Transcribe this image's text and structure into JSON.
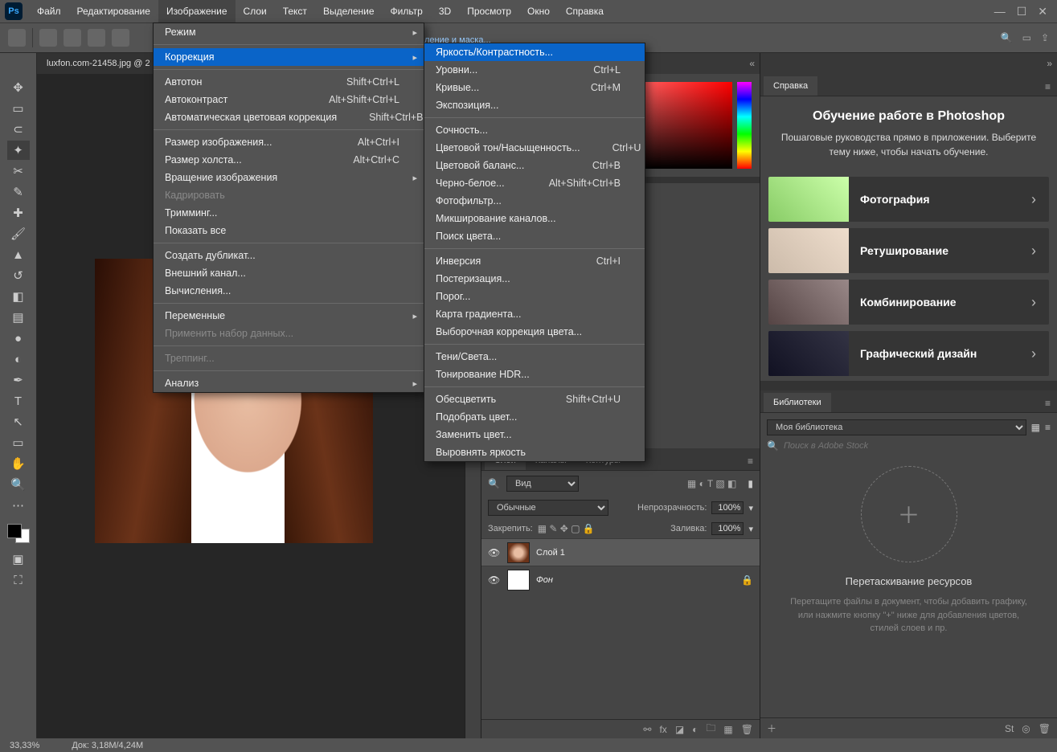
{
  "menubar": {
    "logo": "Ps",
    "items": [
      "Файл",
      "Редактирование",
      "Изображение",
      "Слои",
      "Текст",
      "Выделение",
      "Фильтр",
      "3D",
      "Просмотр",
      "Окно",
      "Справка"
    ],
    "active_index": 2
  },
  "doc_tab": "luxfon.com-21458.jpg @ 2",
  "partial_tab_text": "ление и маска...",
  "status": {
    "zoom": "33,33%",
    "doc": "Док: 3,18M/4,24M"
  },
  "menu_image": [
    {
      "t": "Режим",
      "sub": true
    },
    {
      "sep": true
    },
    {
      "t": "Коррекция",
      "sub": true,
      "hov": true
    },
    {
      "sep": true
    },
    {
      "t": "Автотон",
      "sc": "Shift+Ctrl+L"
    },
    {
      "t": "Автоконтраст",
      "sc": "Alt+Shift+Ctrl+L"
    },
    {
      "t": "Автоматическая цветовая коррекция",
      "sc": "Shift+Ctrl+B"
    },
    {
      "sep": true
    },
    {
      "t": "Размер изображения...",
      "sc": "Alt+Ctrl+I"
    },
    {
      "t": "Размер холста...",
      "sc": "Alt+Ctrl+C"
    },
    {
      "t": "Вращение изображения",
      "sub": true
    },
    {
      "t": "Кадрировать",
      "dis": true
    },
    {
      "t": "Тримминг..."
    },
    {
      "t": "Показать все"
    },
    {
      "sep": true
    },
    {
      "t": "Создать дубликат..."
    },
    {
      "t": "Внешний канал..."
    },
    {
      "t": "Вычисления..."
    },
    {
      "sep": true
    },
    {
      "t": "Переменные",
      "sub": true
    },
    {
      "t": "Применить набор данных...",
      "dis": true
    },
    {
      "sep": true
    },
    {
      "t": "Треппинг...",
      "dis": true
    },
    {
      "sep": true
    },
    {
      "t": "Анализ",
      "sub": true
    }
  ],
  "menu_correction": [
    {
      "t": "Яркость/Контрастность...",
      "hov": true
    },
    {
      "t": "Уровни...",
      "sc": "Ctrl+L"
    },
    {
      "t": "Кривые...",
      "sc": "Ctrl+M"
    },
    {
      "t": "Экспозиция..."
    },
    {
      "sep": true
    },
    {
      "t": "Сочность..."
    },
    {
      "t": "Цветовой тон/Насыщенность...",
      "sc": "Ctrl+U"
    },
    {
      "t": "Цветовой баланс...",
      "sc": "Ctrl+B"
    },
    {
      "t": "Черно-белое...",
      "sc": "Alt+Shift+Ctrl+B"
    },
    {
      "t": "Фотофильтр..."
    },
    {
      "t": "Микширование каналов..."
    },
    {
      "t": "Поиск цвета..."
    },
    {
      "sep": true
    },
    {
      "t": "Инверсия",
      "sc": "Ctrl+I"
    },
    {
      "t": "Постеризация..."
    },
    {
      "t": "Порог..."
    },
    {
      "t": "Карта градиента..."
    },
    {
      "t": "Выборочная коррекция цвета..."
    },
    {
      "sep": true
    },
    {
      "t": "Тени/Света..."
    },
    {
      "t": "Тонирование HDR..."
    },
    {
      "sep": true
    },
    {
      "t": "Обесцветить",
      "sc": "Shift+Ctrl+U"
    },
    {
      "t": "Подобрать цвет..."
    },
    {
      "t": "Заменить цвет..."
    },
    {
      "t": "Выровнять яркость"
    }
  ],
  "layers_panel": {
    "tabs": [
      "Слои",
      "Каналы",
      "Контуры"
    ],
    "kind": "Вид",
    "blend": "Обычные",
    "opacity_label": "Непрозрачность:",
    "opacity": "100%",
    "lock_label": "Закрепить:",
    "fill_label": "Заливка:",
    "fill": "100%",
    "rows": [
      {
        "name": "Слой 1",
        "sel": true
      },
      {
        "name": "Фон",
        "bg": true,
        "locked": true
      }
    ]
  },
  "help_panel": {
    "tab": "Справка",
    "title": "Обучение работе в Photoshop",
    "sub": "Пошаговые руководства прямо в приложении. Выберите тему ниже, чтобы начать обучение.",
    "items": [
      "Фотография",
      "Ретуширование",
      "Комбинирование",
      "Графический дизайн"
    ]
  },
  "libraries": {
    "tab": "Библиотеки",
    "select": "Моя библиотека",
    "search_ph": "Поиск в Adobe Stock",
    "dz_title": "Перетаскивание ресурсов",
    "dz_sub": "Перетащите файлы в документ, чтобы добавить графику, или нажмите кнопку \"+\" ниже для добавления цветов, стилей слоев и пр."
  }
}
